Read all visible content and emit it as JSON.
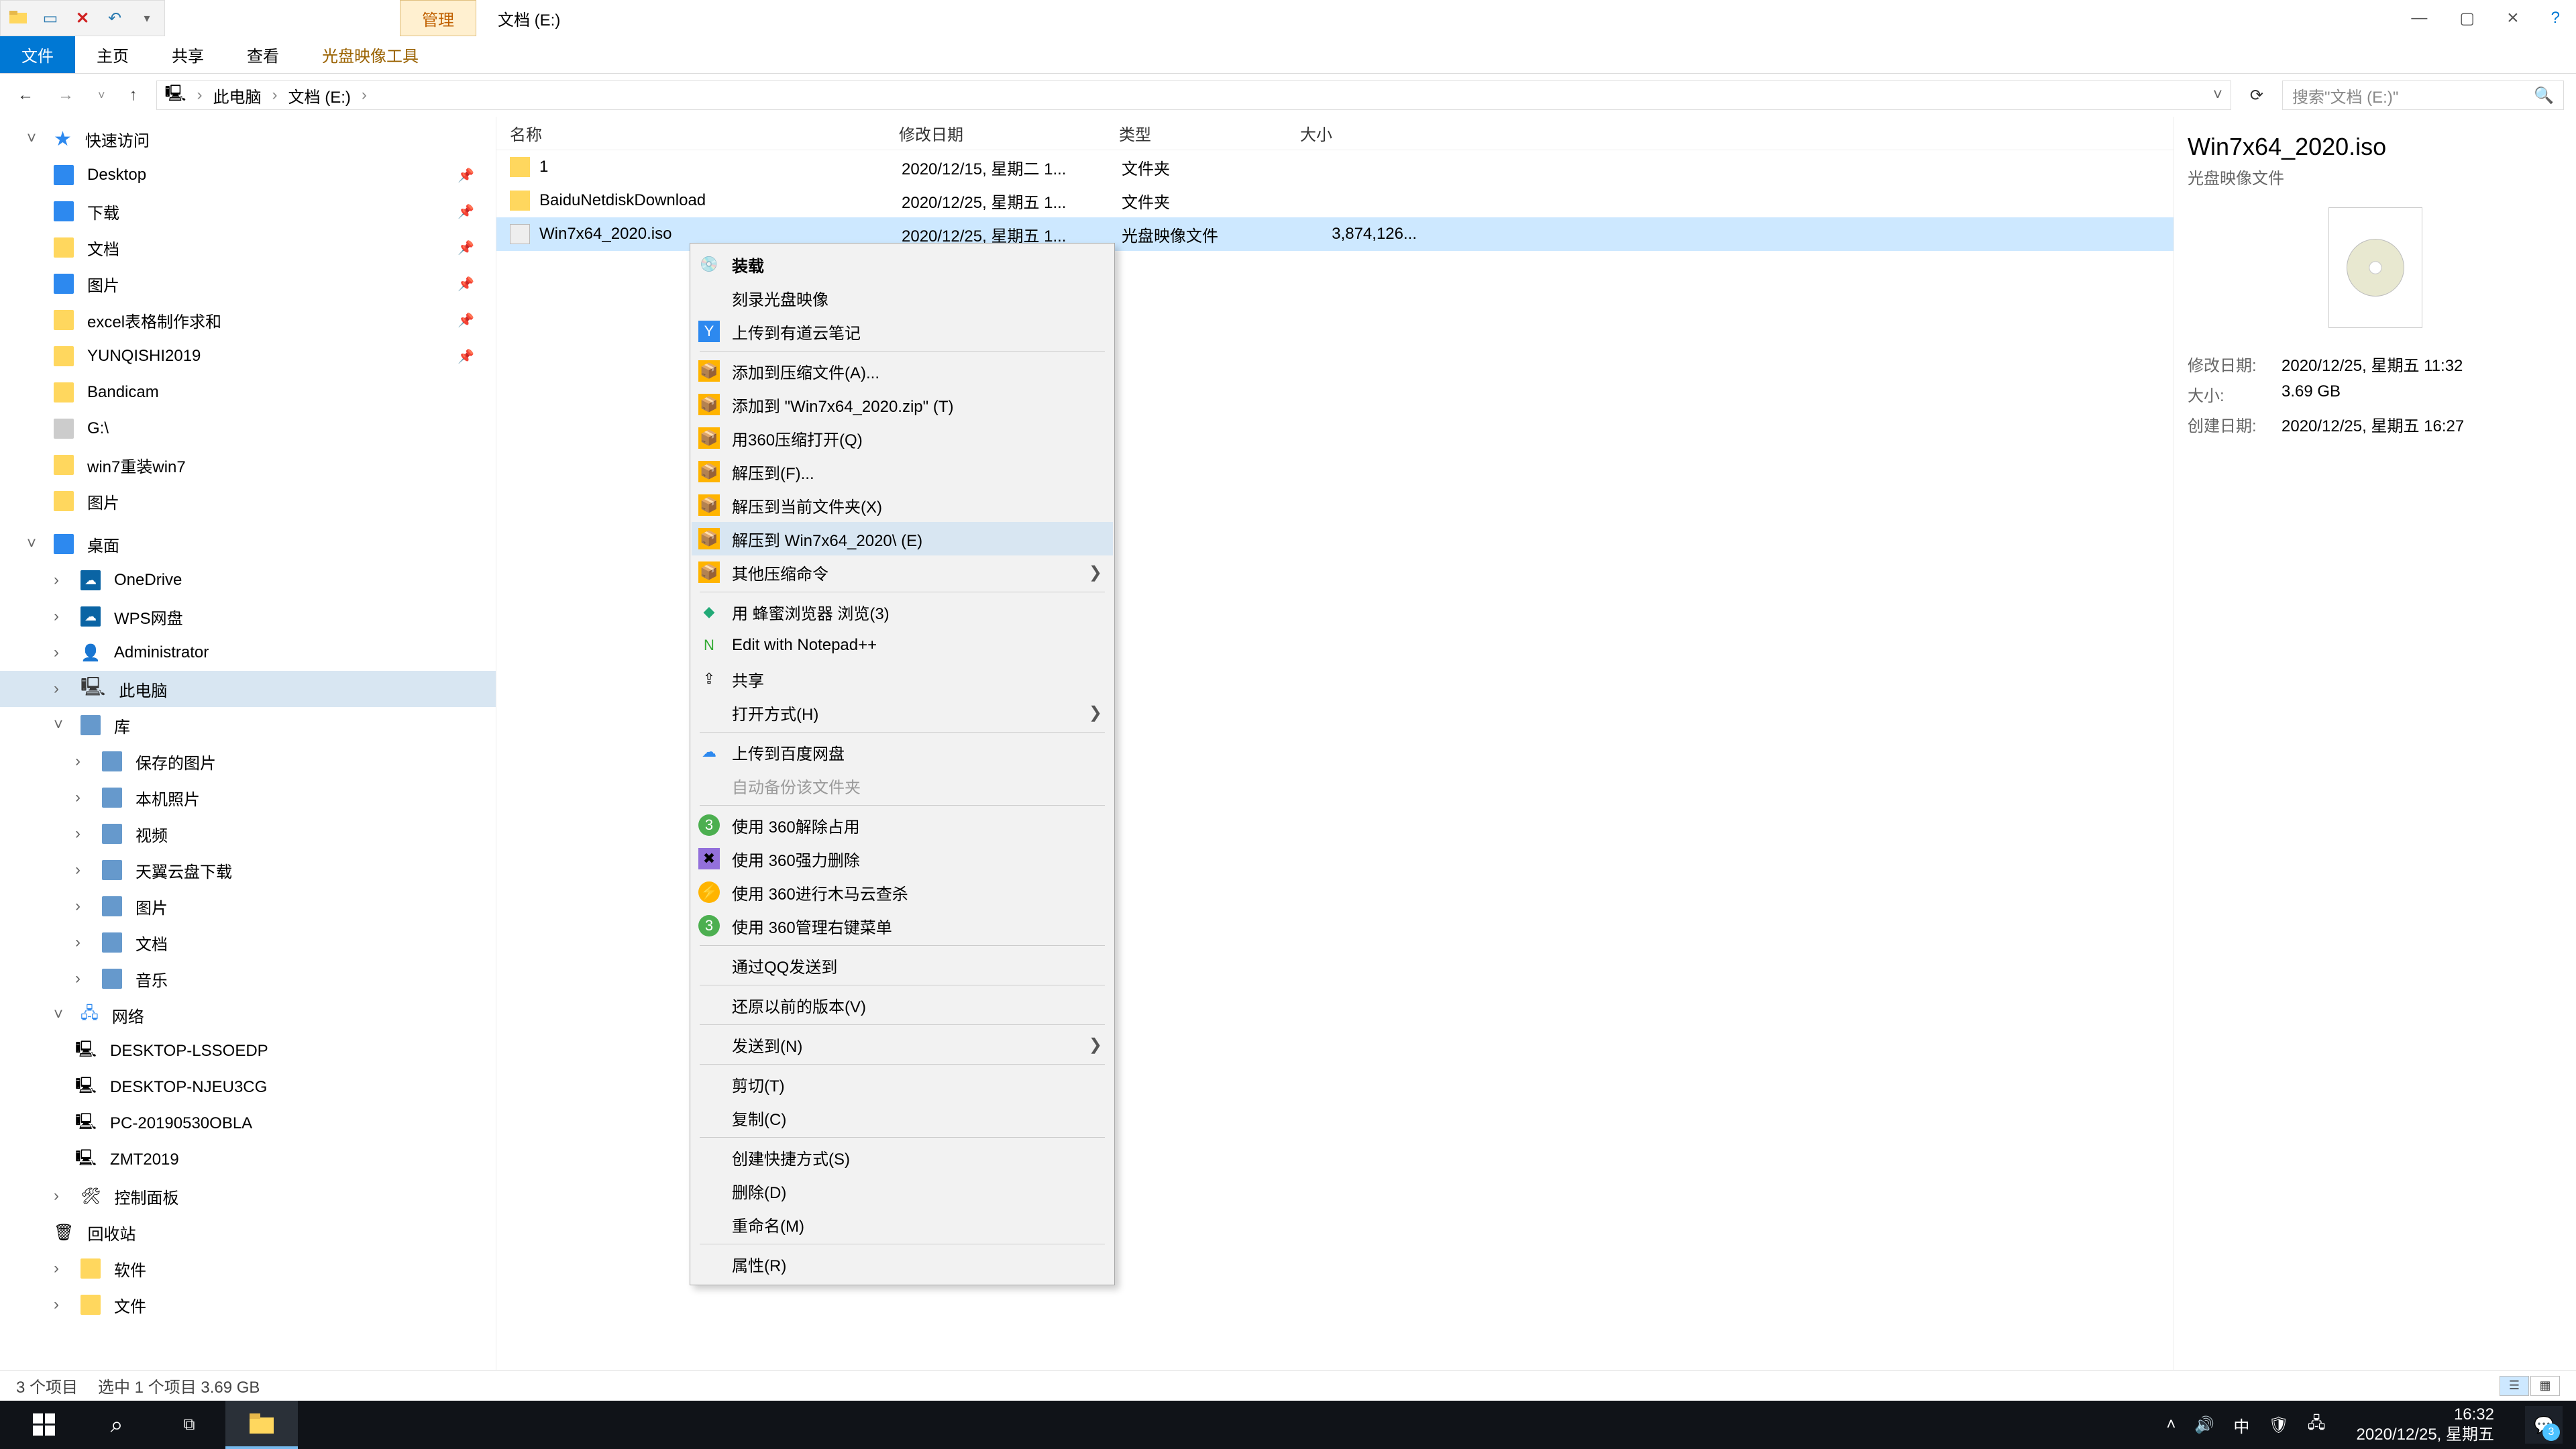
{
  "window": {
    "ctx_tab": "管理",
    "title": "文档 (E:)"
  },
  "ribbon": {
    "file": "文件",
    "home": "主页",
    "share": "共享",
    "view": "查看",
    "disc_tools": "光盘映像工具"
  },
  "nav": {
    "root": "此电脑",
    "loc": "文档 (E:)",
    "search_placeholder": "搜索\"文档 (E:)\""
  },
  "tree": {
    "quick": "快速访问",
    "desktop": "Desktop",
    "downloads": "下载",
    "documents": "文档",
    "pictures": "图片",
    "excel": "excel表格制作求和",
    "yunqishi": "YUNQISHI2019",
    "bandicam": "Bandicam",
    "gdrive": "G:\\",
    "win7": "win7重装win7",
    "pics2": "图片",
    "deskcat": "桌面",
    "onedrive": "OneDrive",
    "wps": "WPS网盘",
    "admin": "Administrator",
    "thispc": "此电脑",
    "lib": "库",
    "saved": "保存的图片",
    "camera": "本机照片",
    "video": "视频",
    "tianyi": "天翼云盘下载",
    "pics3": "图片",
    "docs3": "文档",
    "music": "音乐",
    "network": "网络",
    "pc1": "DESKTOP-LSSOEDP",
    "pc2": "DESKTOP-NJEU3CG",
    "pc3": "PC-20190530OBLA",
    "pc4": "ZMT2019",
    "cp": "控制面板",
    "recycle": "回收站",
    "soft": "软件",
    "filecat": "文件"
  },
  "cols": {
    "name": "名称",
    "date": "修改日期",
    "type": "类型",
    "size": "大小"
  },
  "files": [
    {
      "name": "1",
      "date": "2020/12/15, 星期二 1...",
      "type": "文件夹",
      "size": ""
    },
    {
      "name": "BaiduNetdiskDownload",
      "date": "2020/12/25, 星期五 1...",
      "type": "文件夹",
      "size": ""
    },
    {
      "name": "Win7x64_2020.iso",
      "date": "2020/12/25, 星期五 1...",
      "type": "光盘映像文件",
      "size": "3,874,126..."
    }
  ],
  "menu": {
    "mount": "装载",
    "burn": "刻录光盘映像",
    "youdao": "上传到有道云笔记",
    "addarc": "添加到压缩文件(A)...",
    "addzip": "添加到 \"Win7x64_2020.zip\" (T)",
    "open360": "用360压缩打开(Q)",
    "extractto": "解压到(F)...",
    "extracthere": "解压到当前文件夹(X)",
    "extractfolder": "解压到 Win7x64_2020\\ (E)",
    "othercomp": "其他压缩命令",
    "bee": "用 蜂蜜浏览器 浏览(3)",
    "npp": "Edit with Notepad++",
    "share": "共享",
    "openwith": "打开方式(H)",
    "baidu": "上传到百度网盘",
    "autobak": "自动备份该文件夹",
    "unlock360": "使用 360解除占用",
    "del360": "使用 360强力删除",
    "scan360": "使用 360进行木马云查杀",
    "mgr360": "使用 360管理右键菜单",
    "qqsend": "通过QQ发送到",
    "restore": "还原以前的版本(V)",
    "sendto": "发送到(N)",
    "cut": "剪切(T)",
    "copy": "复制(C)",
    "shortcut": "创建快捷方式(S)",
    "delete": "删除(D)",
    "rename": "重命名(M)",
    "props": "属性(R)"
  },
  "details": {
    "title": "Win7x64_2020.iso",
    "subtitle": "光盘映像文件",
    "mdate_k": "修改日期:",
    "mdate_v": "2020/12/25, 星期五 11:32",
    "size_k": "大小:",
    "size_v": "3.69 GB",
    "cdate_k": "创建日期:",
    "cdate_v": "2020/12/25, 星期五 16:27"
  },
  "status": {
    "count": "3 个项目",
    "sel": "选中 1 个项目  3.69 GB"
  },
  "taskbar": {
    "time": "16:32",
    "date": "2020/12/25, 星期五",
    "ime": "中",
    "notif_count": "3"
  }
}
